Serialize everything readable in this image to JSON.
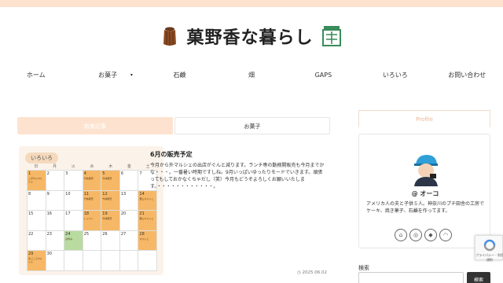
{
  "site": {
    "title": "菓野香な暮らし"
  },
  "nav": {
    "items": [
      {
        "label": "ホーム"
      },
      {
        "label": "お菓子",
        "caret": "▾"
      },
      {
        "label": "石鹸"
      },
      {
        "label": "畑"
      },
      {
        "label": "GAPS"
      },
      {
        "label": "いろいろ"
      },
      {
        "label": "お問い合わせ"
      }
    ]
  },
  "tabs": [
    {
      "label": "新着記事",
      "active": true
    },
    {
      "label": "お菓子",
      "active": false
    }
  ],
  "post": {
    "category": "いろいろ",
    "title": "6月の販売予定",
    "excerpt": "今月から外マルシェの出店がぐんと減ります。ランチ専の勤務開販売も今月までかな・・・。一番暑い時期ですしね。9月いっぱいゆったりモードでいきます。頑張ってもしておかなくちゃだし（笑）今月もどうぞよろしくお願いいたします。・・・・・・・・・・・・。",
    "date": "2025.06.02",
    "calendar": {
      "weekdays": [
        "日",
        "月",
        "火",
        "水",
        "木",
        "金",
        "土"
      ],
      "cells": [
        {
          "day": "1",
          "hl": true,
          "ev": "こぎれいマルシェ"
        },
        {
          "day": "2"
        },
        {
          "day": "3"
        },
        {
          "day": "4",
          "hl": true,
          "ev": "竹林販売"
        },
        {
          "day": "5",
          "hl": true,
          "ev": "竹林販売"
        },
        {
          "day": "6"
        },
        {
          "day": "7"
        },
        {
          "day": "8"
        },
        {
          "day": "9"
        },
        {
          "day": "10"
        },
        {
          "day": "11",
          "hl": true,
          "ev": "竹林販売"
        },
        {
          "day": "12",
          "hl": true,
          "ev": "竹林販売"
        },
        {
          "day": "13"
        },
        {
          "day": "14",
          "hl": true,
          "ev": "里山マルシェ"
        },
        {
          "day": "15"
        },
        {
          "day": "16"
        },
        {
          "day": "17"
        },
        {
          "day": "18",
          "hl": true,
          "ev": "レッスン"
        },
        {
          "day": "19",
          "hl": true,
          "ev": "竹林販売"
        },
        {
          "day": "20"
        },
        {
          "day": "21",
          "hl": true,
          "ev": "里山マルシェ"
        },
        {
          "day": "22"
        },
        {
          "day": "23"
        },
        {
          "day": "24",
          "gr": true,
          "ev": "お休み"
        },
        {
          "day": "25"
        },
        {
          "day": "26"
        },
        {
          "day": "27"
        },
        {
          "day": "28",
          "hl": true,
          "ev": "マルシェ"
        },
        {
          "day": "29",
          "hl": true,
          "ev": "まごころマルシェ"
        },
        {
          "day": "30"
        },
        {
          "day": ""
        },
        {
          "day": ""
        },
        {
          "day": ""
        },
        {
          "day": ""
        },
        {
          "day": ""
        }
      ]
    }
  },
  "sidebar": {
    "profile_heading": "Profile",
    "user_name": "@ オーコ",
    "bio": "アメリカ人の夫と子供５人。神奈川のプチ田舎の工房でケーキ、焼き菓子、石鹸を作ってます。",
    "social_icons": [
      "home-icon",
      "instagram-icon",
      "feedly-icon",
      "rss-icon"
    ],
    "search_label": "検索",
    "search_placeholder": "",
    "search_button": "検索"
  },
  "recaptcha": {
    "text": "プライバシー - 利用規約"
  },
  "colors": {
    "accent": "#fde3cf",
    "highlight": "#f6b866",
    "green": "#b9dba0"
  }
}
